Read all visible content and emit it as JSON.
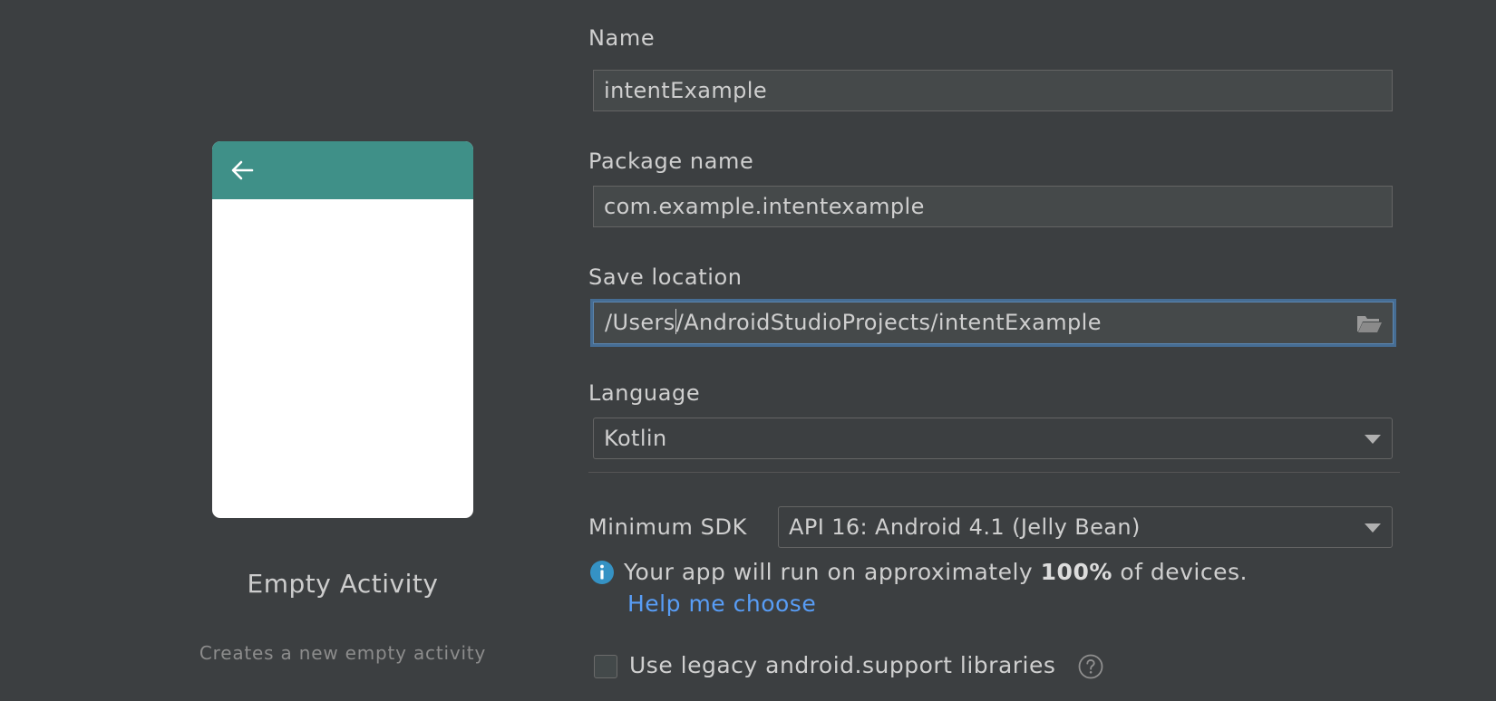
{
  "template": {
    "title": "Empty Activity",
    "description": "Creates a new empty activity",
    "toolbar_color": "#3f9088",
    "back_icon": "arrow-left-icon"
  },
  "form": {
    "name": {
      "label": "Name",
      "value": "intentExample"
    },
    "package_name": {
      "label": "Package name",
      "value": "com.example.intentexample"
    },
    "save_location": {
      "label": "Save location",
      "value_before_caret": "/Users",
      "value_after_caret": "/AndroidStudioProjects/intentExample",
      "browse_icon": "folder-open-icon"
    },
    "language": {
      "label": "Language",
      "selected": "Kotlin"
    },
    "minimum_sdk": {
      "label": "Minimum SDK",
      "selected": "API 16: Android 4.1 (Jelly Bean)"
    },
    "info": {
      "icon": "info-icon",
      "text_before": "Your app will run on approximately ",
      "percentage": "100%",
      "text_after": " of devices.",
      "help_link": "Help me choose"
    },
    "legacy_support": {
      "label": "Use legacy android.support libraries",
      "checked": false,
      "help_icon": "question-circle-icon"
    }
  },
  "colors": {
    "background": "#3c3f41",
    "field_background": "#45494a",
    "focus_border": "#466d94",
    "link": "#589df6",
    "info_icon": "#3592c4"
  }
}
